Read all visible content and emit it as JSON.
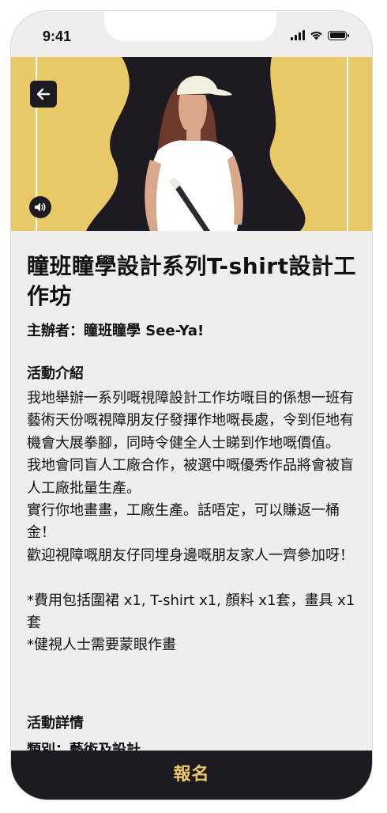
{
  "status_bar": {
    "time": "9:41"
  },
  "hero": {
    "image_alt": "Illustration of a woman in a white t-shirt and cap holding a paintbrush",
    "colors": {
      "background": "#e9c867",
      "shape": "#1d1b21"
    }
  },
  "event": {
    "title": "瞳班瞳學設計系列T-shirt設計工作坊",
    "organizer": "主辦者：瞳班瞳學 See-Ya!"
  },
  "sections": {
    "intro_title": "活動介紹",
    "intro_paragraphs": [
      "我地舉辦一系列嘅視障設計工作坊嘅目的係想一班有藝術天份嘅視障朋友仔發揮作地嘅長處，令到佢地有機會大展拳腳，同時令健全人士睇到作地嘅價值。\n我地會同盲人工廠合作，被選中嘅優秀作品將會被盲人工廠批量生產。\n實行你地畫畫，工廠生產。話唔定，可以賺返一桶金！\n歡迎視障嘅朋友仔同埋身邊嘅朋友家人一齊參加呀！",
      "*費用包括圍裙 x1, T-shirt x1, 顏料 x1套，畫具 x1套\n*健視人士需要蒙眼作畫"
    ],
    "details_title": "活動詳情",
    "details_first_row": "類別：藝術及設計"
  },
  "cta": {
    "label": "報名"
  }
}
